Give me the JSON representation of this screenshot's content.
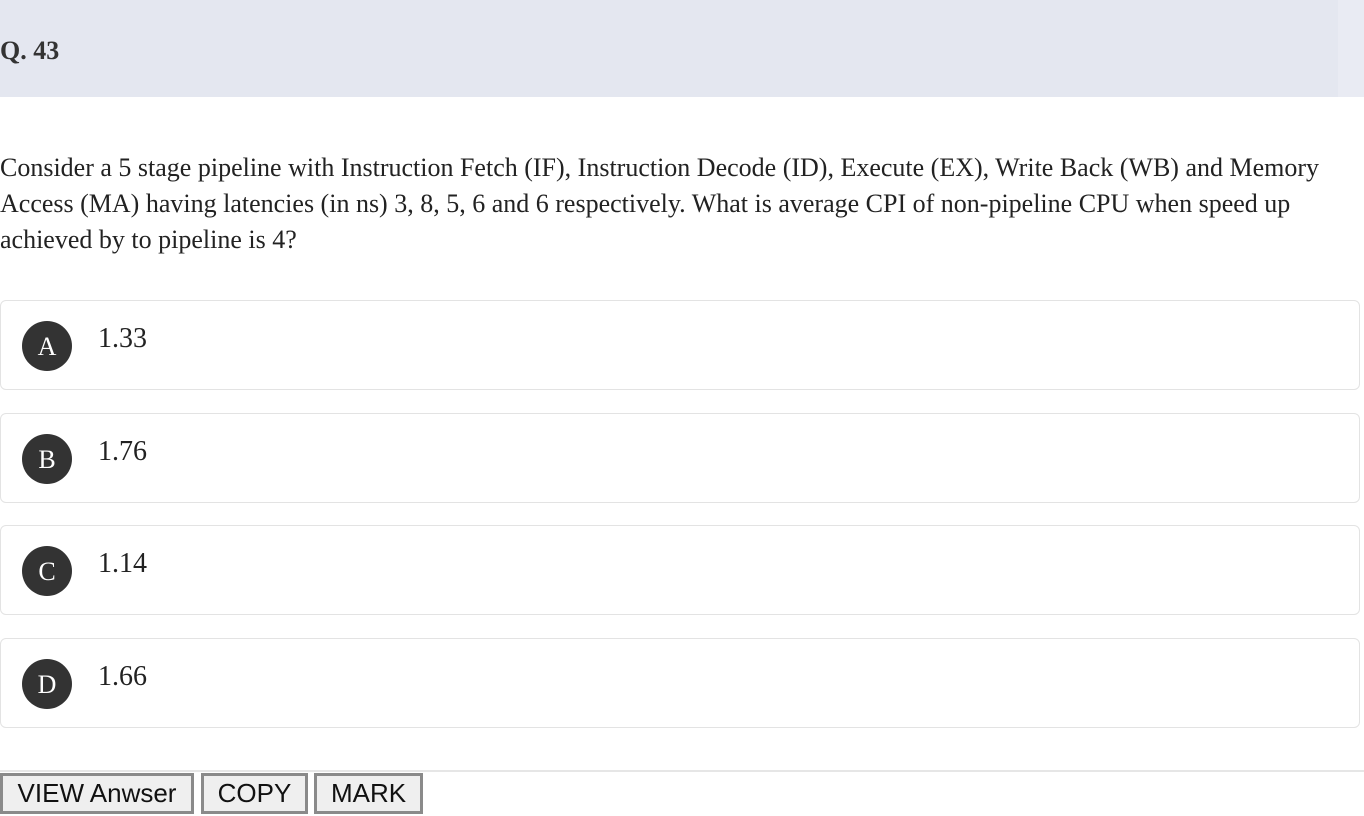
{
  "header": {
    "question_number": "Q. 43"
  },
  "question": {
    "text": "Consider a 5 stage pipeline with Instruction Fetch (IF), Instruction Decode (ID), Execute (EX), Write Back (WB) and Memory Access (MA) having latencies (in ns) 3, 8, 5, 6 and 6 respectively. What is average CPI of non-pipeline CPU when speed up achieved by to pipeline is 4?"
  },
  "options": [
    {
      "letter": "A",
      "value": "1.33"
    },
    {
      "letter": "B",
      "value": "1.76"
    },
    {
      "letter": "C",
      "value": "1.14"
    },
    {
      "letter": "D",
      "value": "1.66"
    }
  ],
  "actions": {
    "view_label": "VIEW Anwser",
    "copy_label": "COPY",
    "mark_label": "MARK"
  },
  "colors": {
    "header_bg": "#e4e7f0",
    "badge_bg": "#333333"
  }
}
